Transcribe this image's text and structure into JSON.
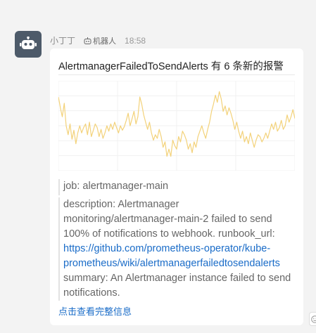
{
  "message": {
    "sender": "小丁丁",
    "badge": "机器人",
    "time": "18:58",
    "title": "AlertmanagerFailedToSendAlerts 有 6 条新的报警",
    "job": "job: alertmanager-main",
    "description_prefix": "description: Alertmanager monitoring/alertmanager-main-2 failed to send 100% of notifications to webhook. runbook_url: ",
    "runbook_link": "https://github.com/prometheus-operator/kube-prometheus/wiki/alertmanagerfailedtosendalerts",
    "summary": "summary: An Alertmanager instance failed to send notifications.",
    "view_full": "点击查看完整信息"
  },
  "icons": {
    "avatar": "robot-icon",
    "badge": "robot-icon",
    "side": "emoji-icon"
  },
  "colors": {
    "avatar_bg": "#4d5a69",
    "line": "#f3d27a",
    "link": "#1a6cc8"
  },
  "chart_data": {
    "type": "line",
    "title": "",
    "xlabel": "",
    "ylabel": "",
    "ylim": [
      0,
      10
    ],
    "grid": true,
    "series": [
      {
        "values": [
          8.2,
          7.0,
          6.0,
          7.5,
          5.0,
          4.0,
          5.2,
          3.5,
          4.5,
          3.0,
          4.2,
          5.0,
          4.2,
          4.8,
          5.2,
          4.0,
          5.4,
          3.8,
          4.5,
          5.2,
          4.8,
          3.8,
          4.6,
          3.6,
          4.2,
          5.0,
          4.4,
          5.2,
          4.6,
          5.4,
          4.8,
          4.2,
          5.0,
          4.5,
          4.9,
          5.6,
          6.4,
          5.0,
          5.8,
          6.6,
          5.2,
          6.0,
          8.2,
          7.4,
          6.2,
          5.4,
          4.6,
          5.4,
          4.2,
          3.4,
          4.0,
          3.6,
          4.6,
          3.8,
          2.6,
          3.2,
          1.6,
          2.4,
          1.6,
          3.4,
          2.8,
          2.4,
          3.8,
          3.2,
          4.4,
          4.0,
          3.4,
          2.4,
          3.0,
          2.0,
          3.2,
          2.6,
          3.8,
          4.4,
          5.0,
          4.2,
          3.6,
          4.6,
          5.4,
          6.6,
          7.4,
          8.4,
          7.6,
          8.8,
          8.0,
          6.6,
          7.2,
          6.2,
          7.0,
          6.4,
          5.6,
          4.6,
          5.4,
          4.4,
          3.6,
          4.4,
          3.2,
          3.8,
          3.0,
          4.2,
          3.4,
          2.6,
          3.4,
          4.0,
          3.8,
          3.2,
          3.6,
          4.2,
          3.6,
          4.4,
          5.2,
          4.6,
          5.4,
          4.4,
          4.8,
          5.6,
          4.6,
          5.0,
          6.2,
          5.4,
          6.0,
          6.8,
          5.8
        ]
      }
    ]
  }
}
